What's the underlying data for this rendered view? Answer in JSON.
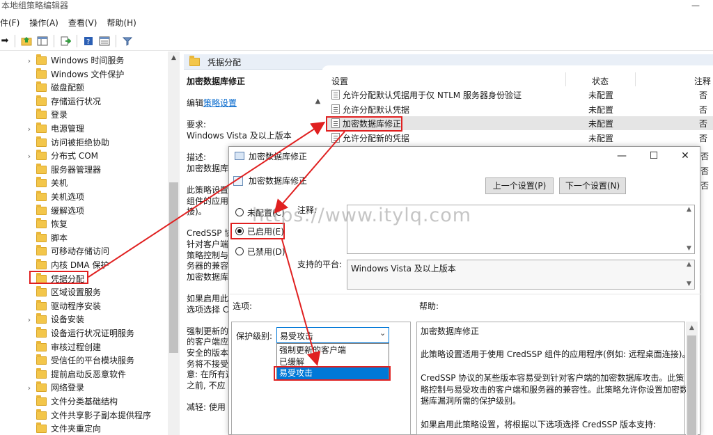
{
  "window": {
    "title": "本地组策略编辑器",
    "minimize_label": "—"
  },
  "menu": [
    "件(F)",
    "操作(A)",
    "查看(V)",
    "帮助(H)"
  ],
  "toolbar": {
    "icons": [
      "forward-icon",
      "up-folder-icon",
      "show-hide-tree-icon",
      "export-list-icon",
      "help-icon",
      "properties-icon",
      "filter-icon"
    ]
  },
  "tree": {
    "items": [
      {
        "label": "Windows 时间服务",
        "expandable": true
      },
      {
        "label": "Windows 文件保护",
        "expandable": false
      },
      {
        "label": "磁盘配额",
        "expandable": false
      },
      {
        "label": "存储运行状况",
        "expandable": false
      },
      {
        "label": "登录",
        "expandable": false
      },
      {
        "label": "电源管理",
        "expandable": true
      },
      {
        "label": "访问被拒绝协助",
        "expandable": false
      },
      {
        "label": "分布式 COM",
        "expandable": true
      },
      {
        "label": "服务器管理器",
        "expandable": false
      },
      {
        "label": "关机",
        "expandable": false
      },
      {
        "label": "关机选项",
        "expandable": false
      },
      {
        "label": "缓解选项",
        "expandable": false
      },
      {
        "label": "恢复",
        "expandable": false
      },
      {
        "label": "脚本",
        "expandable": false
      },
      {
        "label": "可移动存储访问",
        "expandable": false
      },
      {
        "label": "内核 DMA 保护",
        "expandable": false
      },
      {
        "label": "凭据分配",
        "expandable": false
      },
      {
        "label": "区域设置服务",
        "expandable": false
      },
      {
        "label": "驱动程序安装",
        "expandable": false
      },
      {
        "label": "设备安装",
        "expandable": true
      },
      {
        "label": "设备运行状况证明服务",
        "expandable": false
      },
      {
        "label": "审核过程创建",
        "expandable": false
      },
      {
        "label": "受信任的平台模块服务",
        "expandable": false
      },
      {
        "label": "提前启动反恶意软件",
        "expandable": false
      },
      {
        "label": "网络登录",
        "expandable": true
      },
      {
        "label": "文件分类基础结构",
        "expandable": false
      },
      {
        "label": "文件共享影子副本提供程序",
        "expandable": false
      },
      {
        "label": "文件夹重定向",
        "expandable": false
      }
    ]
  },
  "right_header": {
    "title": "凭据分配"
  },
  "description": {
    "lines": [
      "加密数据库修正",
      "",
      "编辑策略设置",
      "",
      "要求:",
      "Windows Vista 及以上版本",
      "",
      "描述:",
      "加密数据库",
      "",
      "此策略设置",
      "组件的应用",
      "接)。",
      "",
      "CredSSP 协",
      "针对客户端",
      "策略控制与",
      "务器的兼容",
      "加密数据库",
      "",
      "如果启用此",
      "选项选择 C",
      "",
      "强制更新的",
      "的客户端应",
      "安全的版本",
      "务将不接受",
      "意: 在所有这",
      "之前, 不应",
      "",
      "减轻: 使用"
    ],
    "edit_prefix": "编辑",
    "edit_link": "策略设置"
  },
  "list": {
    "headers": {
      "setting": "设置",
      "state": "状态",
      "comment": "注释"
    },
    "rows": [
      {
        "name": "允许分配默认凭据用于仅 NTLM 服务器身份验证",
        "state": "未配置",
        "comment": "否"
      },
      {
        "name": "允许分配默认凭据",
        "state": "未配置",
        "comment": "否"
      },
      {
        "name": "加密数据库修正",
        "state": "未配置",
        "comment": "否"
      },
      {
        "name": "允许分配新的凭据",
        "state": "未配置",
        "comment": "否"
      }
    ],
    "extra_comments": [
      "否",
      "否",
      "否"
    ]
  },
  "dialog": {
    "title": "加密数据库修正",
    "subtitle": "加密数据库修正",
    "prev_button": "上一个设置(P)",
    "next_button": "下一个设置(N)",
    "radios": [
      {
        "label": "未配置(C)",
        "checked": false
      },
      {
        "label": "已启用(E)",
        "checked": true
      },
      {
        "label": "已禁用(D)",
        "checked": false
      }
    ],
    "comment_label": "注释:",
    "platform_label": "支持的平台:",
    "platform_value": "Windows Vista 及以上版本",
    "options_label": "选项:",
    "help_label": "帮助:",
    "protection_label": "保护级别:",
    "protection_value": "易受攻击",
    "protection_options": [
      "强制更新的客户端",
      "已缓解",
      "易受攻击"
    ],
    "help_lines": [
      "加密数据库修正",
      "",
      "此策略设置适用于使用 CredSSP 组件的应用程序(例如: 远程桌面连接)。",
      "",
      "CredSSP 协议的某些版本容易受到针对客户端的加密数据库攻击。此策",
      "略控制与易受攻击的客户端和服务器的兼容性。此策略允许你设置加密数",
      "据库漏洞所需的保护级别。",
      "",
      "如果启用此策略设置，将根据以下选项选择 CredSSP 版本支持:"
    ]
  },
  "watermark": "https://www.itylq.com",
  "colors": {
    "highlight": "#e02020",
    "selection": "#0078d7",
    "folder": "#f3c64a"
  }
}
